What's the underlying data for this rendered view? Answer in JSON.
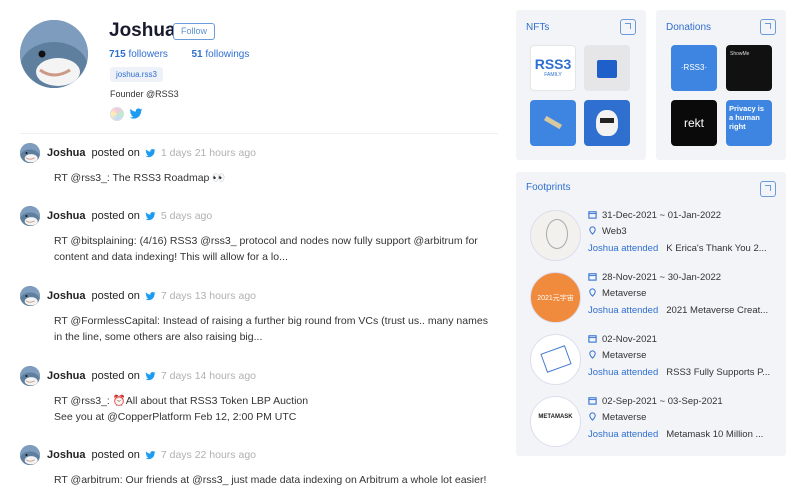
{
  "profile": {
    "name": "Joshua",
    "follow_label": "Follow",
    "followers_count": "715",
    "followers_label": "followers",
    "followings_count": "51",
    "followings_label": "followings",
    "handle": "joshua.rss3",
    "bio": "Founder @RSS3"
  },
  "posted_on_label": "posted on",
  "posts": [
    {
      "user": "Joshua",
      "time": "1 days 21 hours ago",
      "text": "RT @rss3_: The RSS3 Roadmap 👀"
    },
    {
      "user": "Joshua",
      "time": "5 days ago",
      "text": "RT @bitsplaining: (4/16) RSS3 @rss3_ protocol and nodes now fully support @arbitrum for content and data indexing! This will allow for a lo..."
    },
    {
      "user": "Joshua",
      "time": "7 days 13 hours ago",
      "text": "RT @FormlessCapital: Instead of raising a further big round from VCs (trust us.. many names in the line, some others are also raising big..."
    },
    {
      "user": "Joshua",
      "time": "7 days 14 hours ago",
      "text_line1": "RT @rss3_: ⏰All about that RSS3 Token LBP Auction",
      "text_line2": "See you at @CopperPlatform Feb 12, 2:00 PM UTC"
    },
    {
      "user": "Joshua",
      "time": "7 days 22 hours ago",
      "text": "RT @arbitrum: Our friends at @rss3_ just made data indexing on Arbitrum a whole lot easier!"
    }
  ],
  "nfts": {
    "title": "NFTs",
    "tile1_text": "RSS3",
    "tile1_sub": "FAMILY"
  },
  "donations": {
    "title": "Donations",
    "tile1_text": "·RSS3·",
    "tile2_text": "ShowMe",
    "tile3_text": "rekt",
    "tile4_text": "Privacy is a human right"
  },
  "footprints": {
    "title": "Footprints",
    "items": [
      {
        "dates": "31-Dec-2021 ~ 01-Jan-2022",
        "location": "Web3",
        "attended": "Joshua attended",
        "event": "K Erica's Thank You 2..."
      },
      {
        "dates": "28-Nov-2021 ~ 30-Jan-2022",
        "location": "Metaverse",
        "attended": "Joshua attended",
        "event": "2021 Metaverse Creat...",
        "thumb_text": "2021元宇宙"
      },
      {
        "dates": "02-Nov-2021",
        "location": "Metaverse",
        "attended": "Joshua attended",
        "event": "RSS3 Fully Supports P..."
      },
      {
        "dates": "02-Sep-2021 ~ 03-Sep-2021",
        "location": "Metaverse",
        "attended": "Joshua attended",
        "event": "Metamask 10 Million ...",
        "thumb_text": "METAMASK"
      }
    ]
  },
  "colors": {
    "accent": "#2f6fd0",
    "twitter": "#1d9bf0",
    "card_bg": "#f3f4f7"
  }
}
